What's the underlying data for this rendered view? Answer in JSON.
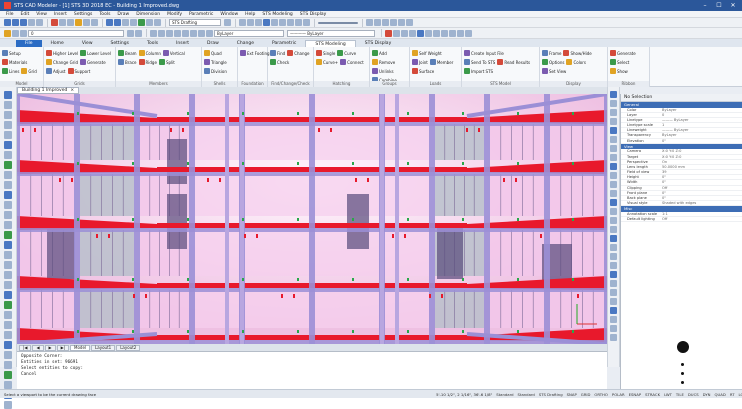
{
  "window": {
    "title": "STS CAD Modeler - [1] STS 3D 2018 EC - Building 1 Improved.dwg",
    "controls": [
      "–",
      "☐",
      "✕"
    ]
  },
  "menu": [
    "File",
    "Edit",
    "View",
    "Insert",
    "Settings",
    "Tools",
    "Draw",
    "Dimension",
    "Modify",
    "Parametric",
    "Window",
    "Help",
    "STS Modeling",
    "STS Display"
  ],
  "toolbar_top": {
    "workspace": "STS Drafting",
    "layer": "ByLayer",
    "linetype": "———— ByLayer",
    "layer_combo": "0"
  },
  "ribbon": {
    "tabs": [
      "File",
      "Home",
      "View",
      "Settings",
      "Tools",
      "Insert",
      "Draw",
      "Change",
      "Parametric",
      "STS Modeling",
      "STS Display"
    ],
    "active_tab": "STS Modeling",
    "groups": [
      {
        "name": "Model",
        "buttons": [
          "Setup",
          "Materials",
          "Lines",
          "Grid"
        ]
      },
      {
        "name": "Grids",
        "buttons": [
          "Higher Level",
          "Lower Level",
          "Change Grid",
          "Generate",
          "Adjust",
          "Support"
        ]
      },
      {
        "name": "Members",
        "buttons": [
          "Beam",
          "Column",
          "Vertical",
          "Brace",
          "Ridge",
          "Split"
        ]
      },
      {
        "name": "Shells",
        "buttons": [
          "Quad",
          "Triangle",
          "Division"
        ]
      },
      {
        "name": "Foundation",
        "buttons": [
          "Ext Footing"
        ]
      },
      {
        "name": "Find/Change/Check",
        "buttons": [
          "Find",
          "Change",
          "Check"
        ]
      },
      {
        "name": "Hatching",
        "buttons": [
          "Single",
          "Curve",
          "Curve+",
          "Connect"
        ]
      },
      {
        "name": "Groups",
        "buttons": [
          "Add",
          "Remove",
          "Unlinks",
          "Combine"
        ]
      },
      {
        "name": "Loads",
        "buttons": [
          "Self Weight",
          "Joint",
          "Member",
          "Surface"
        ]
      },
      {
        "name": "STS Model",
        "buttons": [
          "Create Input File",
          "Send To STS",
          "Read Results",
          "Import STS"
        ]
      },
      {
        "name": "Display",
        "buttons": [
          "Frame",
          "Show/Hide",
          "Options",
          "Colors",
          "Set View"
        ]
      },
      {
        "name": "Ribbon",
        "buttons": [
          "Generate",
          "Select",
          "Show"
        ]
      }
    ]
  },
  "document_tab": "Building 1 Improved",
  "layout_tabs": [
    "Model",
    "Layout1",
    "Layout2"
  ],
  "command_lines": [
    "Opposite Corner:",
    "Entities in set: 96691",
    "Select entities to copy:",
    "Cancel"
  ],
  "properties": {
    "header": "No Selection",
    "sections": [
      {
        "title": "General",
        "rows": [
          [
            "Color",
            "ByLayer"
          ],
          [
            "Layer",
            "0"
          ],
          [
            "Linetype",
            "——— ByLayer"
          ],
          [
            "Linetype scale",
            "1"
          ],
          [
            "Lineweight",
            "——— ByLayer"
          ],
          [
            "Transparency",
            "ByLayer"
          ],
          [
            "Elevation",
            "0\""
          ]
        ]
      },
      {
        "title": "View",
        "rows": [
          [
            "Camera",
            "X:0  Y:0  Z:0"
          ],
          [
            "Target",
            "X:0  Y:0  Z:0"
          ],
          [
            "Perspective",
            "On"
          ],
          [
            "Lens length",
            "50.0000 mm"
          ],
          [
            "Field of view",
            "39"
          ],
          [
            "Height",
            "0\""
          ],
          [
            "Width",
            "0\""
          ],
          [
            "Clipping",
            "Off"
          ],
          [
            "Front plane",
            "0\""
          ],
          [
            "Back plane",
            "0\""
          ],
          [
            "Visual style",
            "Shaded with edges"
          ]
        ]
      },
      {
        "title": "Misc",
        "rows": [
          [
            "Annotation scale",
            "1:1"
          ],
          [
            "Default lighting",
            "Off"
          ]
        ]
      }
    ]
  },
  "status": {
    "message": "Select a viewport to be the current drawing face",
    "coords": "5'-10 1/2\", 2 1/16\", 36'-6 1/8\"",
    "items": [
      "Standard",
      "Standard",
      "STS Drafting",
      "SNAP",
      "GRID",
      "ORTHO",
      "POLAR",
      "ESNAP",
      "STRACK",
      "LWT",
      "TILE",
      "DUCS",
      "DYN",
      "QUAD",
      "RT",
      "LOCKUI",
      "None"
    ]
  },
  "colors": {
    "accent": "#2b579a",
    "slab_red": "#e8192c",
    "wall_pink": "#f3bfe6",
    "beam_purple": "#9b8fd6"
  }
}
